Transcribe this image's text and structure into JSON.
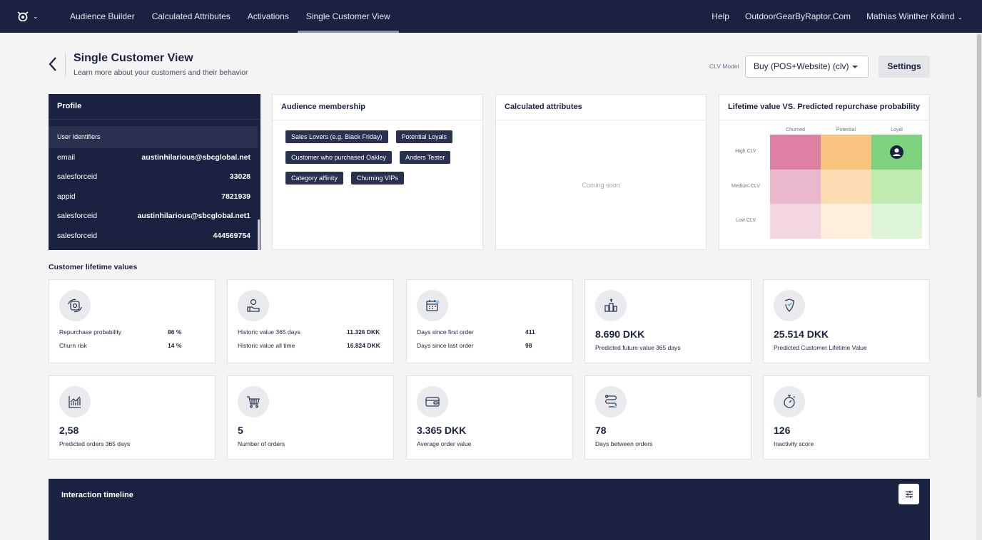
{
  "nav": {
    "items": [
      "Audience Builder",
      "Calculated Attributes",
      "Activations",
      "Single Customer View"
    ],
    "active_index": 3,
    "help": "Help",
    "account": "OutdoorGearByRaptor.Com",
    "user": "Mathias Winther Kolind"
  },
  "header": {
    "title": "Single Customer View",
    "subtitle": "Learn more about your customers and their behavior",
    "clv_model_label": "CLV Model",
    "clv_model_value": "Buy (POS+Website) (clv)",
    "settings_label": "Settings"
  },
  "profile": {
    "title": "Profile",
    "identifiers_header": "User Identifiers",
    "rows": [
      {
        "key": "email",
        "value": "austinhilarious@sbcglobal.net"
      },
      {
        "key": "salesforceid",
        "value": "33028"
      },
      {
        "key": "appid",
        "value": "7821939"
      },
      {
        "key": "salesforceid",
        "value": "austinhilarious@sbcglobal.net1"
      },
      {
        "key": "salesforceid",
        "value": "444569754"
      }
    ]
  },
  "audience": {
    "title": "Audience membership",
    "chip_rows": [
      [
        "Sales Lovers (e.g. Black Friday)",
        "Potential Loyals"
      ],
      [
        "Customer who purchased Oakley",
        "Anders Tester"
      ],
      [
        "Category affinity",
        "Churning VIPs"
      ]
    ]
  },
  "calculated": {
    "title": "Calculated attributes",
    "empty_text": "Coming soon"
  },
  "ltv_matrix": {
    "title": "Lifetime value VS. Predicted repurchase probability",
    "columns": [
      "Churned",
      "Potential",
      "Loyal"
    ],
    "rows": [
      "High CLV",
      "Medium CLV",
      "Low CLV"
    ],
    "colors": [
      [
        "#de7fa4",
        "#f8c27f",
        "#7ed47e"
      ],
      [
        "#eab8cc",
        "#fbdcb3",
        "#c0ebb0"
      ],
      [
        "#f3d6e1",
        "#fdefdc",
        "#def4d6"
      ]
    ],
    "customer_position": {
      "row": "High CLV",
      "column": "Loyal"
    }
  },
  "clv": {
    "section_title": "Customer lifetime values",
    "cards": [
      {
        "icon": "repurchase-icon",
        "lines": [
          {
            "label": "Repurchase probability",
            "value": "86 %"
          },
          {
            "label": "Churn risk",
            "value": "14 %"
          }
        ]
      },
      {
        "icon": "historic-value-icon",
        "lines": [
          {
            "label": "Historic value 365 days",
            "value": "11.326 DKK"
          },
          {
            "label": "Historic value all time",
            "value": "16.824 DKK"
          }
        ]
      },
      {
        "icon": "calendar-icon",
        "lines": [
          {
            "label": "Days since first order",
            "value": "411"
          },
          {
            "label": "Days since last order",
            "value": "98"
          }
        ]
      },
      {
        "icon": "coins-icon",
        "big": "8.690 DKK",
        "caption": "Predicted future value 365 days"
      },
      {
        "icon": "clv-shield-icon",
        "big": "25.514 DKK",
        "caption": "Predicted Customer Lifetime Value"
      },
      {
        "icon": "growth-chart-icon",
        "big": "2,58",
        "caption": "Predicted orders 365 days"
      },
      {
        "icon": "cart-icon",
        "big": "5",
        "caption": "Number of orders"
      },
      {
        "icon": "wallet-icon",
        "big": "3.365 DKK",
        "caption": "Average order value"
      },
      {
        "icon": "route-icon",
        "big": "78",
        "caption": "Days between orders"
      },
      {
        "icon": "stopwatch-icon",
        "big": "126",
        "caption": "Inactivity score"
      }
    ]
  },
  "timeline": {
    "title": "Interaction timeline"
  }
}
